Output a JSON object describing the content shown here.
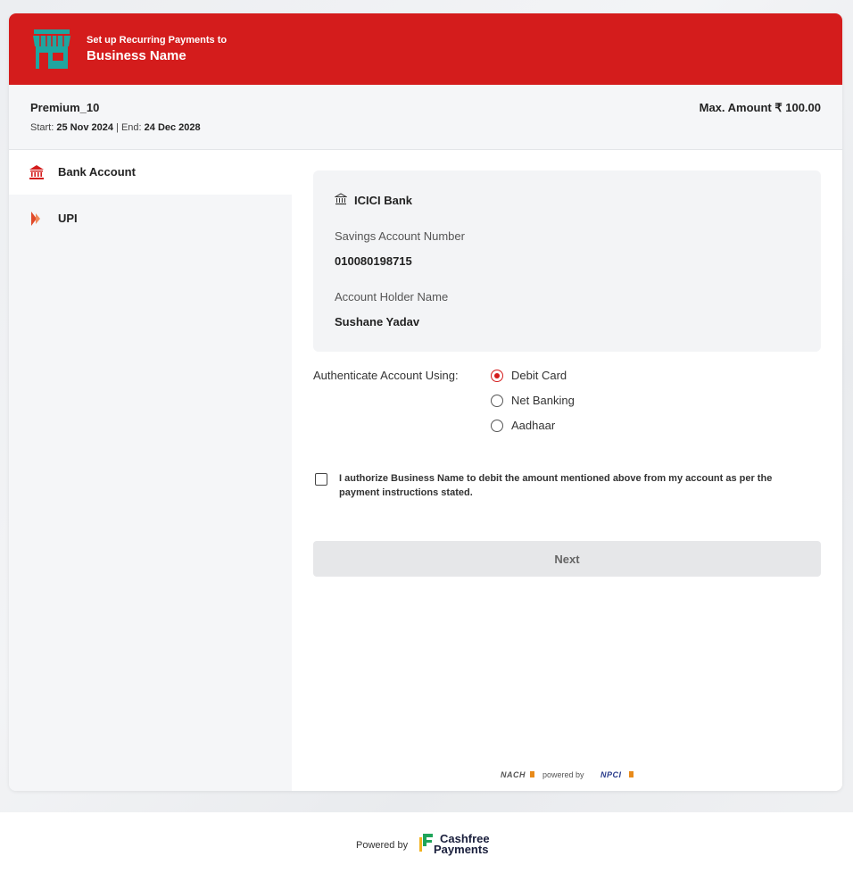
{
  "header": {
    "subtitle": "Set up Recurring Payments to",
    "business_name": "Business Name",
    "icon": "store-icon"
  },
  "plan": {
    "name": "Premium_10",
    "start_label": "Start:",
    "start_date": "25 Nov 2024",
    "separator": "|",
    "end_label": "End:",
    "end_date": "24 Dec 2028",
    "max_amount": "Max. Amount ₹ 100.00"
  },
  "sidebar": {
    "items": [
      {
        "label": "Bank Account",
        "icon": "bank-icon",
        "active": true
      },
      {
        "label": "UPI",
        "icon": "upi-icon",
        "active": false
      }
    ]
  },
  "bank": {
    "name": "ICICI Bank",
    "account_label": "Savings Account Number",
    "account_number": "010080198715",
    "holder_label": "Account Holder Name",
    "holder_name": "Sushane Yadav"
  },
  "auth": {
    "label": "Authenticate Account Using:",
    "options": [
      {
        "label": "Debit Card",
        "selected": true
      },
      {
        "label": "Net Banking",
        "selected": false
      },
      {
        "label": "Aadhaar",
        "selected": false
      }
    ]
  },
  "consent": {
    "checked": false,
    "text": "I authorize Business Name to debit the amount mentioned above from my account as per the payment instructions stated."
  },
  "actions": {
    "next_label": "Next"
  },
  "nach": {
    "nach_logo": "NACH",
    "powered_by": "powered by",
    "npci_logo": "NPCI"
  },
  "footer": {
    "powered_by": "Powered by",
    "brand_line1": "Cashfree",
    "brand_line2": "Payments"
  },
  "colors": {
    "accent": "#d41c1c",
    "store_icon": "#1fa5a0",
    "sidebar_bg": "#f5f6f8",
    "button_disabled_bg": "#e6e7e9"
  }
}
